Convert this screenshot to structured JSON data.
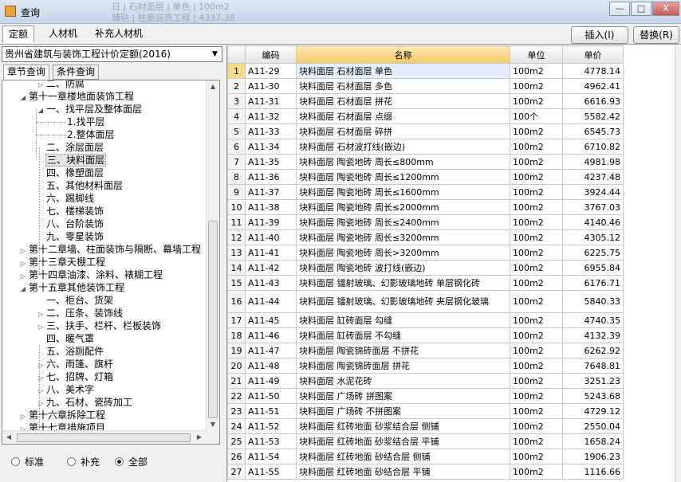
{
  "window": {
    "title": "查询",
    "bg_rows": [
      "日 | 石材面层 | 单色 | 100m2",
      "铺贴 | 柱面装饰工程 | 4337.38"
    ],
    "controls": {
      "minimize": "—",
      "restore": "□",
      "close": "X"
    }
  },
  "tabs": [
    "定额",
    "人材机",
    "补充人材机"
  ],
  "actions": {
    "insert": "插入(I)",
    "replace": "替换(R)"
  },
  "quota_select": {
    "value": "贵州省建筑与装饰工程计价定额(2016)"
  },
  "subtabs": [
    "章节查询",
    "条件查询"
  ],
  "tree": [
    {
      "label": "二、防腐",
      "level": 2,
      "exp": "▷"
    },
    {
      "label": "第十一章楼地面装饰工程",
      "level": 1,
      "exp": "◢"
    },
    {
      "label": "一、找平层及整体面层",
      "level": 2,
      "exp": "◢"
    },
    {
      "label": "1.找平层",
      "level": 3,
      "exp": ""
    },
    {
      "label": "2.整体面层",
      "level": 3,
      "exp": ""
    },
    {
      "label": "二、涂层面层",
      "level": 2,
      "exp": ""
    },
    {
      "label": "三、块料面层",
      "level": 2,
      "exp": "",
      "selected": true
    },
    {
      "label": "四、橡塑面层",
      "level": 2,
      "exp": ""
    },
    {
      "label": "五、其他材料面层",
      "level": 2,
      "exp": ""
    },
    {
      "label": "六、踢脚线",
      "level": 2,
      "exp": ""
    },
    {
      "label": "七、楼梯装饰",
      "level": 2,
      "exp": ""
    },
    {
      "label": "八、台阶装饰",
      "level": 2,
      "exp": ""
    },
    {
      "label": "九、零星装饰",
      "level": 2,
      "exp": ""
    },
    {
      "label": "第十二章墙、柱面装饰与隔断、幕墙工程",
      "level": 1,
      "exp": "▷"
    },
    {
      "label": "第十三章天棚工程",
      "level": 1,
      "exp": "▷"
    },
    {
      "label": "第十四章油漆、涂料、裱糊工程",
      "level": 1,
      "exp": "▷"
    },
    {
      "label": "第十五章其他装饰工程",
      "level": 1,
      "exp": "◢"
    },
    {
      "label": "一、柜台、货架",
      "level": 2,
      "exp": ""
    },
    {
      "label": "二、压条、装饰线",
      "level": 2,
      "exp": "▷"
    },
    {
      "label": "三、扶手、栏杆、栏板装饰",
      "level": 2,
      "exp": "▷"
    },
    {
      "label": "四、暖气罩",
      "level": 2,
      "exp": ""
    },
    {
      "label": "五、浴厕配件",
      "level": 2,
      "exp": ""
    },
    {
      "label": "六、雨篷、旗杆",
      "level": 2,
      "exp": "▷"
    },
    {
      "label": "七、招牌、灯箱",
      "level": 2,
      "exp": "▷"
    },
    {
      "label": "八、美术字",
      "level": 2,
      "exp": "▷"
    },
    {
      "label": "九、石材、瓷砖加工",
      "level": 2,
      "exp": "▷"
    },
    {
      "label": "第十六章拆除工程",
      "level": 1,
      "exp": "▷"
    },
    {
      "label": "第十七章措施项目",
      "level": 1,
      "exp": "▷"
    }
  ],
  "radio": {
    "options": [
      "标准",
      "补充",
      "全部"
    ],
    "selected": "全部"
  },
  "table": {
    "headers": [
      "",
      "编码",
      "名称",
      "单位",
      "单价"
    ],
    "rows": [
      [
        "1",
        "A11-29",
        "块料面层 石材面层 单色",
        "100m2",
        "4778.14"
      ],
      [
        "2",
        "A11-30",
        "块料面层 石材面层 多色",
        "100m2",
        "4962.41"
      ],
      [
        "3",
        "A11-31",
        "块料面层 石材面层 拼花",
        "100m2",
        "6616.93"
      ],
      [
        "4",
        "A11-32",
        "块料面层 石材面层 点缀",
        "100个",
        "5582.42"
      ],
      [
        "5",
        "A11-33",
        "块料面层 石材面层 碎拼",
        "100m2",
        "6545.73"
      ],
      [
        "6",
        "A11-34",
        "块料面层 石材波打线(嵌边)",
        "100m2",
        "6710.82"
      ],
      [
        "7",
        "A11-35",
        "块料面层 陶瓷地砖 周长≤800mm",
        "100m2",
        "4981.98"
      ],
      [
        "8",
        "A11-36",
        "块料面层 陶瓷地砖 周长≤1200mm",
        "100m2",
        "4237.48"
      ],
      [
        "9",
        "A11-37",
        "块料面层 陶瓷地砖 周长≤1600mm",
        "100m2",
        "3924.44"
      ],
      [
        "10",
        "A11-38",
        "块料面层 陶瓷地砖 周长≤2000mm",
        "100m2",
        "3767.03"
      ],
      [
        "11",
        "A11-39",
        "块料面层 陶瓷地砖 周长≤2400mm",
        "100m2",
        "4140.46"
      ],
      [
        "12",
        "A11-40",
        "块料面层 陶瓷地砖 周长≤3200mm",
        "100m2",
        "4305.12"
      ],
      [
        "13",
        "A11-41",
        "块料面层 陶瓷地砖 周长>3200mm",
        "100m2",
        "6225.75"
      ],
      [
        "14",
        "A11-42",
        "块料面层 陶瓷地砖 波打线(嵌边)",
        "100m2",
        "6955.84"
      ],
      [
        "15",
        "A11-43",
        "块料面层 镭射玻璃、幻影玻璃地砖 单层钢化砖",
        "100m2",
        "6176.71"
      ],
      [
        "16",
        "A11-44",
        "块料面层 镭射玻璃、幻影玻璃地砖 夹层钢化玻璃",
        "100m2",
        "5840.33"
      ],
      [
        "17",
        "A11-45",
        "块料面层 缸砖面层 勾缝",
        "100m2",
        "4740.35"
      ],
      [
        "18",
        "A11-46",
        "块料面层 缸砖面层 不勾缝",
        "100m2",
        "4132.39"
      ],
      [
        "19",
        "A11-47",
        "块料面层 陶瓷锦砖面层 不拼花",
        "100m2",
        "6262.92"
      ],
      [
        "20",
        "A11-48",
        "块料面层 陶瓷锦砖面层 拼花",
        "100m2",
        "7648.81"
      ],
      [
        "21",
        "A11-49",
        "块料面层 水泥花砖",
        "100m2",
        "3251.23"
      ],
      [
        "22",
        "A11-50",
        "块料面层 广场砖 拼图案",
        "100m2",
        "5243.68"
      ],
      [
        "23",
        "A11-51",
        "块料面层 广场砖 不拼图案",
        "100m2",
        "4729.12"
      ],
      [
        "24",
        "A11-52",
        "块料面层 红砖地面 砂浆结合层 侧铺",
        "100m2",
        "2550.04"
      ],
      [
        "25",
        "A11-53",
        "块料面层 红砖地面 砂浆结合层 平铺",
        "100m2",
        "1658.24"
      ],
      [
        "26",
        "A11-54",
        "块料面层 红砖地面 砂结合层 侧铺",
        "100m2",
        "1906.23"
      ],
      [
        "27",
        "A11-55",
        "块料面层 红砖地面 砂结合层 平铺",
        "100m2",
        "1116.66"
      ]
    ]
  }
}
